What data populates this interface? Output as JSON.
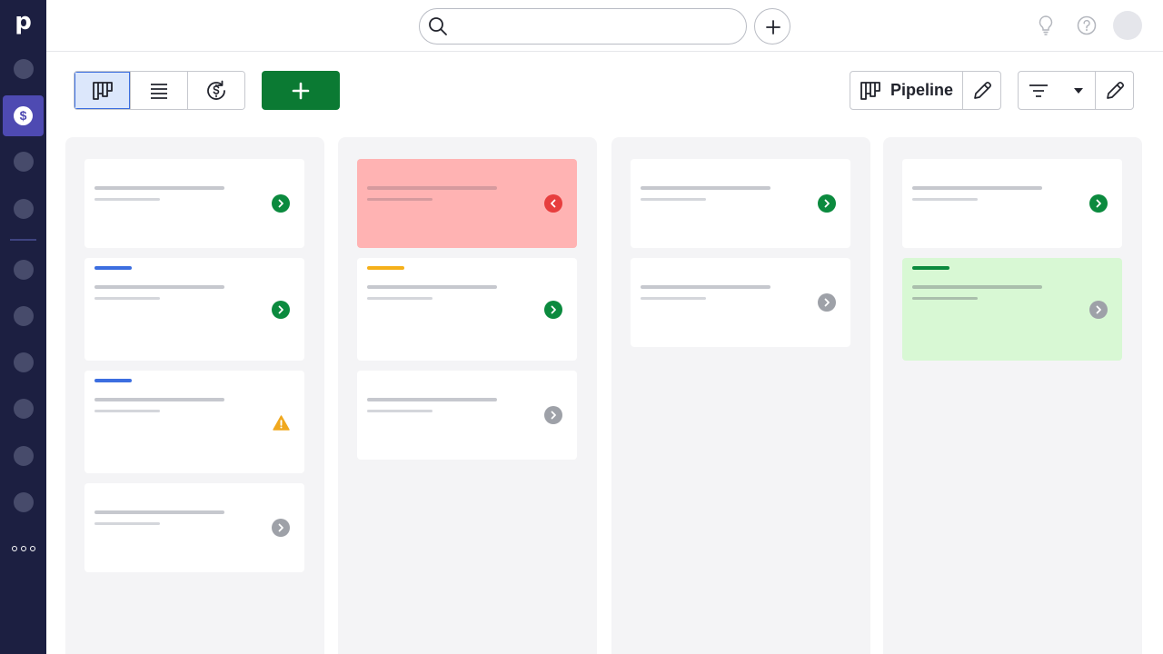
{
  "app": {
    "logo_letter": "p"
  },
  "sidebar": {
    "active_item_icon": "dollar-coin-icon",
    "items": [
      "nav-item-1",
      "nav-item-2",
      "nav-item-3",
      "nav-item-4",
      "nav-item-5",
      "nav-item-6",
      "nav-item-7",
      "nav-item-8"
    ]
  },
  "topbar": {
    "search_placeholder": ""
  },
  "toolbar": {
    "pipeline_label": "Pipeline"
  },
  "colors": {
    "sidebar": "#1c1f41",
    "active": "#4e4ab2",
    "primary": "#0b7a33",
    "status_go": "#0b8a3e",
    "status_idle": "#9ea1a8",
    "status_back": "#e73e3e",
    "warning": "#f0a81e",
    "accent_blue": "#3c6ee0",
    "accent_yellow": "#f5b01a",
    "accent_green": "#0b8a3e"
  },
  "board": {
    "columns": [
      {
        "cards": [
          {
            "accent": null,
            "status": "go",
            "tint": null
          },
          {
            "accent": "blue",
            "status": "go",
            "tint": null
          },
          {
            "accent": "blue",
            "status": "warn",
            "tint": null
          },
          {
            "accent": null,
            "status": "idle",
            "tint": null
          }
        ]
      },
      {
        "cards": [
          {
            "accent": null,
            "status": "back",
            "tint": "red"
          },
          {
            "accent": "yellow",
            "status": "go",
            "tint": null
          },
          {
            "accent": null,
            "status": "idle",
            "tint": null
          }
        ]
      },
      {
        "cards": [
          {
            "accent": null,
            "status": "go",
            "tint": null
          },
          {
            "accent": null,
            "status": "idle",
            "tint": null
          }
        ]
      },
      {
        "cards": [
          {
            "accent": null,
            "status": "go",
            "tint": null
          },
          {
            "accent": "green",
            "status": "idle",
            "tint": "green"
          }
        ]
      }
    ]
  }
}
